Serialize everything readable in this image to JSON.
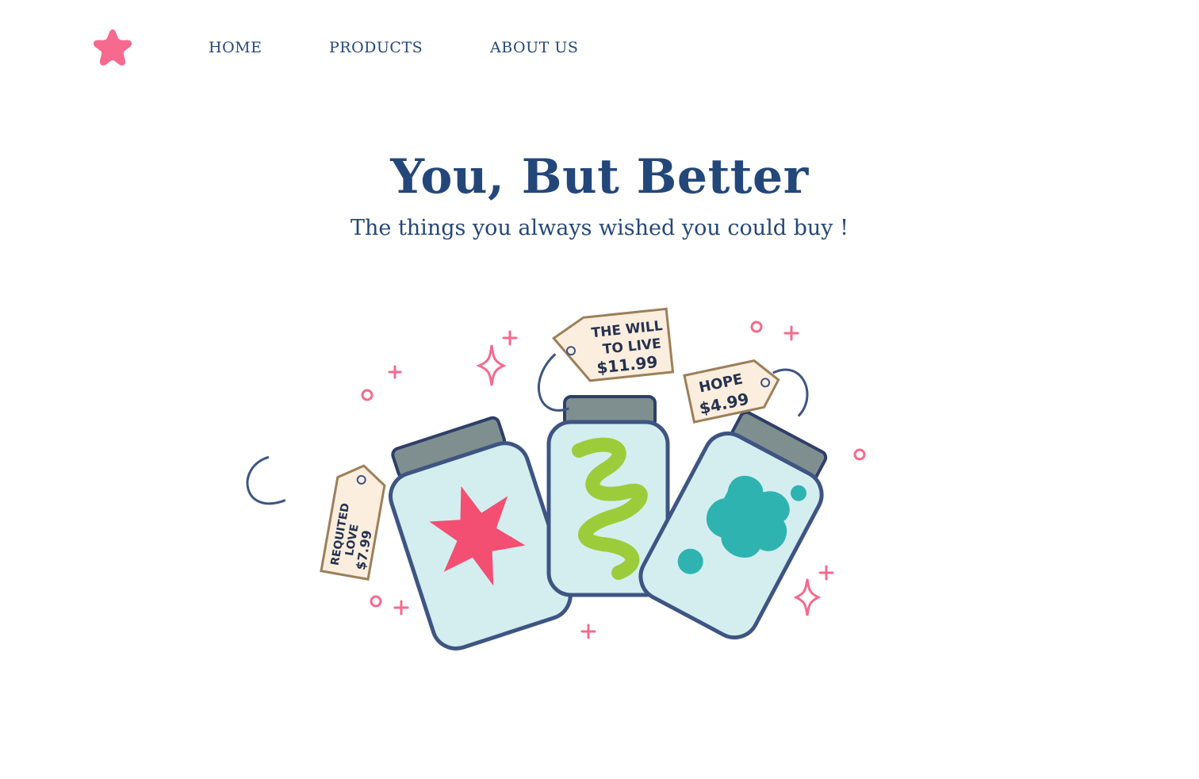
{
  "nav": {
    "logo_icon": "pink-flower-star-icon",
    "items": [
      {
        "label": "HOME"
      },
      {
        "label": "PRODUCTS"
      },
      {
        "label": "ABOUT US"
      }
    ]
  },
  "hero": {
    "title": "You, But Better",
    "subtitle": "The things you always wished you could buy !"
  },
  "illustration": {
    "jars": [
      {
        "tag_line1": "REQUITED",
        "tag_line2": "LOVE",
        "tag_price": "$7.99"
      },
      {
        "tag_line1": "THE WILL",
        "tag_line2": "TO LIVE",
        "tag_price": "$11.99"
      },
      {
        "tag_line1": "HOPE",
        "tag_price": "$4.99"
      }
    ]
  },
  "colors": {
    "brand_pink": "#f56a8e",
    "text_navy": "#24477a",
    "jar_glass": "#d4eef0",
    "jar_lid": "#7f8f8f",
    "tag_paper": "#fbeede",
    "star_pink": "#f24f72",
    "squiggle_green": "#9ccc3a",
    "cloud_teal": "#2fb3b0"
  }
}
